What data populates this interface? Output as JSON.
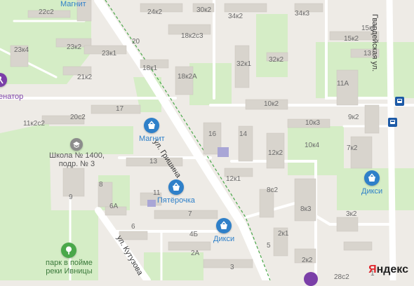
{
  "streets": {
    "grishina": "ул. Гришина",
    "kutuzova": "ул. Кутузова",
    "gvardeiskaya": "Гвардейская ул."
  },
  "houses": [
    "22с2",
    "24к2",
    "30к2",
    "34к2",
    "34к3",
    "18к2с3",
    "20",
    "15к2",
    "15к1",
    "23к4",
    "23к2",
    "23к1",
    "32к1",
    "32к2",
    "13",
    "18к1",
    "18к2А",
    "21к2",
    "11А",
    "17",
    "10к2",
    "9к2",
    "11к2с2",
    "20с2",
    "16",
    "14",
    "10к3",
    "10к4",
    "7к2",
    "12к2",
    "13",
    "8",
    "12к1",
    "8с2",
    "11",
    "9",
    "6А",
    "8к3",
    "7",
    "6",
    "4Б",
    "2к1",
    "3к2",
    "2А",
    "5",
    "3",
    "2к2",
    "28с2",
    "1"
  ],
  "pois": {
    "magnit_top": "Магнит",
    "magnit": "Магнит",
    "pyaterochka": "Пятёрочка",
    "diksi_right": "Дикси",
    "diksi_bottom": "Дикси",
    "school_line1": "Школа № 1400,",
    "school_line2": "подр. № 3",
    "park_line1": "парк в пойме",
    "park_line2": "реки Ивницы",
    "senator": "енатор"
  },
  "icons": {
    "shop": "shopping-basket-icon",
    "school": "school-icon",
    "park": "tree-icon",
    "bus": "bus-stop-icon"
  },
  "colors": {
    "background": "#eeebe6",
    "green_area": "#d5edc6",
    "building": "#d8d4cd",
    "road": "#ffffff",
    "railway": "#4aa84a",
    "poi_blue": "#2f80c9",
    "poi_green": "#4aa84a",
    "poi_purple": "#7b3fa8"
  },
  "brand": {
    "yandex_y": "Я",
    "yandex_rest": "ндекс"
  }
}
